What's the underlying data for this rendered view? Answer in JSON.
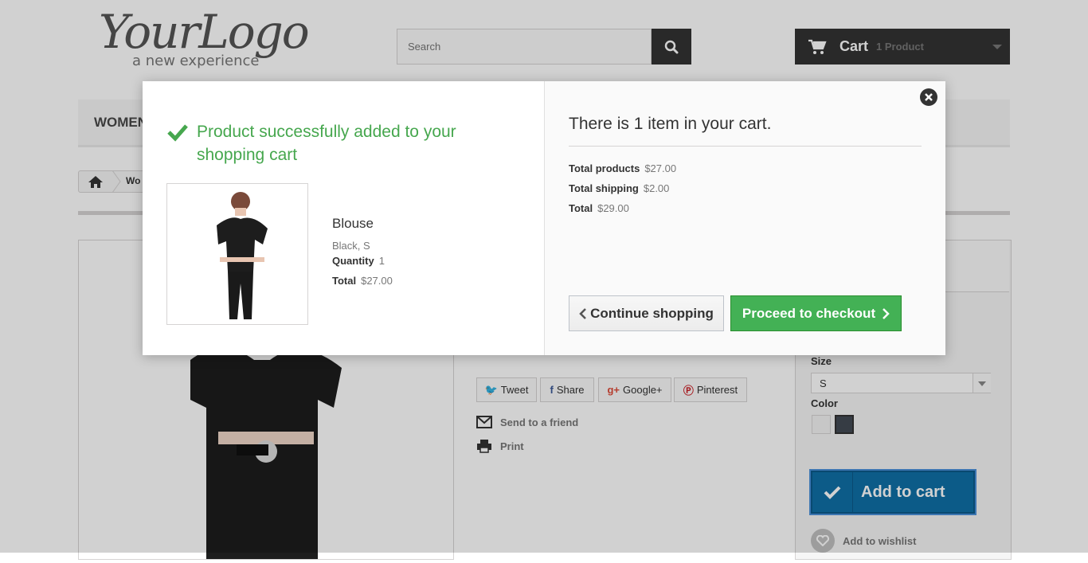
{
  "header": {
    "logo_main": "YourLogo",
    "logo_sub": "a new experience",
    "search_placeholder": "Search",
    "cart_label": "Cart",
    "cart_count": "1 Product"
  },
  "menu": {
    "women": "WOMEN"
  },
  "breadcrumb": {
    "current": "Wo"
  },
  "social": {
    "tweet": "Tweet",
    "share": "Share",
    "googleplus": "Google+",
    "pinterest": "Pinterest"
  },
  "actions": {
    "send_friend": "Send to a friend",
    "print": "Print"
  },
  "options": {
    "size_label": "Size",
    "size_value": "S",
    "color_label": "Color",
    "colors": [
      "#f3f3f3",
      "#434a54"
    ]
  },
  "buttons": {
    "add_to_cart": "Add to cart",
    "add_to_wishlist": "Add to wishlist"
  },
  "modal": {
    "success_title": "Product successfully added to your shopping cart",
    "product_name": "Blouse",
    "product_attributes": "Black, S",
    "quantity_label": "Quantity",
    "quantity_value": "1",
    "total_label": "Total",
    "total_value": "$27.00",
    "cart_heading": "There is 1 item in your cart.",
    "total_products_label": "Total products",
    "total_products_value": "$27.00",
    "total_shipping_label": "Total shipping",
    "total_shipping_value": "$2.00",
    "grand_total_label": "Total",
    "grand_total_value": "$29.00",
    "continue_label": "Continue shopping",
    "checkout_label": "Proceed to checkout"
  },
  "colors": {
    "success_green": "#46a74e",
    "checkout_green": "#43b155",
    "add_cart_blue": "#0f6fa6",
    "dark": "#333333"
  }
}
